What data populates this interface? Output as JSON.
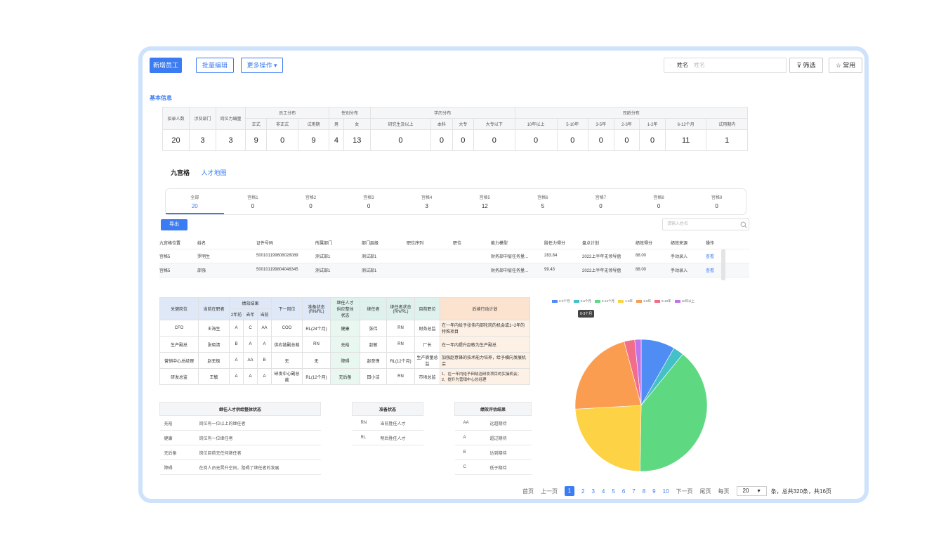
{
  "toolbar": {
    "add_label": "新增员工",
    "batch_label": "批量编辑",
    "more_label": "更多操作",
    "search_field": "姓名",
    "search_placeholder": "姓名",
    "filter_label": "筛选",
    "common_label": "常用"
  },
  "basic": {
    "title": "基本信息",
    "group_headers": [
      "员工分布",
      "性别分布",
      "学历分布",
      "司龄分布"
    ],
    "single_headers": [
      "招录人数",
      "涉及部门",
      "岗位力编量"
    ],
    "sub_headers": [
      "正式",
      "非正式",
      "试用期",
      "男",
      "女",
      "研究生及以上",
      "本科",
      "大专",
      "大专以下",
      "10年以上",
      "5-10年",
      "3-5年",
      "2-3年",
      "1-2年",
      "6-12个月",
      "试用期内"
    ],
    "values": [
      "20",
      "3",
      "3",
      "9",
      "0",
      "9",
      "4",
      "13",
      "0",
      "0",
      "0",
      "0",
      "0",
      "0",
      "0",
      "0",
      "0",
      "11",
      "1"
    ]
  },
  "view_tabs": [
    "九宫格",
    "人才地图"
  ],
  "grid_cells": [
    {
      "label": "全部",
      "count": "20"
    },
    {
      "label": "宫格1",
      "count": "0"
    },
    {
      "label": "宫格2",
      "count": "0"
    },
    {
      "label": "宫格3",
      "count": "0"
    },
    {
      "label": "宫格4",
      "count": "3"
    },
    {
      "label": "宫格5",
      "count": "12"
    },
    {
      "label": "宫格6",
      "count": "5"
    },
    {
      "label": "宫格7",
      "count": "0"
    },
    {
      "label": "宫格8",
      "count": "0"
    },
    {
      "label": "宫格9",
      "count": "0"
    }
  ],
  "export_label": "导出",
  "list_search_placeholder": "请输入姓名",
  "list": {
    "headers": [
      "九宫格位置",
      "姓名",
      "证件号码",
      "所属部门",
      "部门层级",
      "职位序列",
      "职位",
      "能力模型",
      "胜任力得分",
      "盘点计划",
      "绩效得分",
      "绩效来源",
      "操作"
    ],
    "rows": [
      [
        "宫格5",
        "罗明生",
        "500101199608028089",
        "测试部1",
        "测试部1",
        "",
        "",
        "财务部中层任务量...",
        "283.84",
        "2022上半年无领导盘",
        "88.00",
        "手动录入",
        "查看"
      ],
      [
        "宫格5",
        "邵强",
        "500101199804048345",
        "测试部1",
        "测试部1",
        "",
        "",
        "财务部中层任务量...",
        "99.43",
        "2022上半年无领导盘",
        "88.00",
        "手动录入",
        "查看"
      ]
    ]
  },
  "succession": {
    "headers": {
      "post": "关键岗位",
      "holder": "当前在职者",
      "perf": "绩效结果",
      "next": "下一岗位",
      "ready": "准备状态\n(RN/RL)",
      "supply": "继任人才\n供应整体\n状态",
      "successor": "继任者",
      "sready": "继任者状态\n(RN/RL)",
      "cur": "目前职位",
      "plan": "后续行动计划"
    },
    "perf_years": [
      "2年前",
      "去年",
      "当前"
    ],
    "rows": [
      [
        "CFO",
        "王海生",
        "A",
        "C",
        "AA",
        "COO",
        "RL(24个月)",
        "健康",
        "张伟",
        "RN",
        "财务总监",
        "在一年内给予张伟内部轮岗的机会或1~2年的特殊项目"
      ],
      [
        "生产副总",
        "张晓清",
        "B",
        "A",
        "A",
        "供应链副总裁",
        "RN",
        "充裕",
        "赵敏",
        "RN",
        "厂长",
        "在一年内提升赵敏为生产副总"
      ],
      [
        "营销中心总经理",
        "赵无极",
        "A",
        "AA",
        "B",
        "无",
        "无",
        "障碍",
        "赵意锋",
        "RL(12个月)",
        "生产质量总监",
        "加强赵意锋的技术能力培养，给予横向发展机会"
      ],
      [
        "研发总监",
        "王敏",
        "A",
        "A",
        "A",
        "研发中心副总裁",
        "RL(12个月)",
        "无后备",
        "田小洁",
        "RN",
        "市场总监",
        "1、在一年内给予田晓洁研发项目的实操机会；\n2、提升为营销中心总经理"
      ]
    ]
  },
  "supply_legend": {
    "title": "继任人才供给整体状态",
    "rows": [
      [
        "充裕",
        "岗位有一位以上的继任者"
      ],
      [
        "健康",
        "岗位有一位继任者"
      ],
      [
        "无后备",
        "岗位目前无任何继任者"
      ],
      [
        "障碍",
        "在岗人员无晋升空间，阻碍了继任者的发展"
      ]
    ]
  },
  "ready_legend": {
    "title": "准备状态",
    "rows": [
      [
        "RN",
        "当前胜任人才"
      ],
      [
        "RL",
        "明后胜任人才"
      ]
    ]
  },
  "perf_legend": {
    "title": "绩效评估结果",
    "rows": [
      [
        "AA",
        "远超期待"
      ],
      [
        "A",
        "超过期待"
      ],
      [
        "B",
        "达到期待"
      ],
      [
        "C",
        "低于期待"
      ]
    ]
  },
  "chart_data": {
    "type": "pie",
    "legend_position": "top",
    "tooltip": "0-3个月",
    "series": [
      {
        "name": "0-3个月",
        "value": 8.0,
        "color": "#4f8df5"
      },
      {
        "name": "3-6个月",
        "value": 2.5,
        "color": "#44c1c6"
      },
      {
        "name": "6-12个月",
        "value": 38.0,
        "color": "#5fd882"
      },
      {
        "name": "1-3年",
        "value": 23.0,
        "color": "#fdd244"
      },
      {
        "name": "3-5年",
        "value": 21.0,
        "color": "#fb9d50"
      },
      {
        "name": "5-10年",
        "value": 2.5,
        "color": "#f26d8a"
      },
      {
        "name": "10年以上",
        "value": 1.5,
        "color": "#c174e8"
      }
    ]
  },
  "pager": {
    "first": "首页",
    "prev": "上一页",
    "pages": [
      "1",
      "2",
      "3",
      "4",
      "5",
      "6",
      "7",
      "8",
      "9",
      "10"
    ],
    "next": "下一页",
    "last": "尾页",
    "per_page": "每页",
    "size": "20",
    "summary": "条，总共320条，共16页"
  }
}
